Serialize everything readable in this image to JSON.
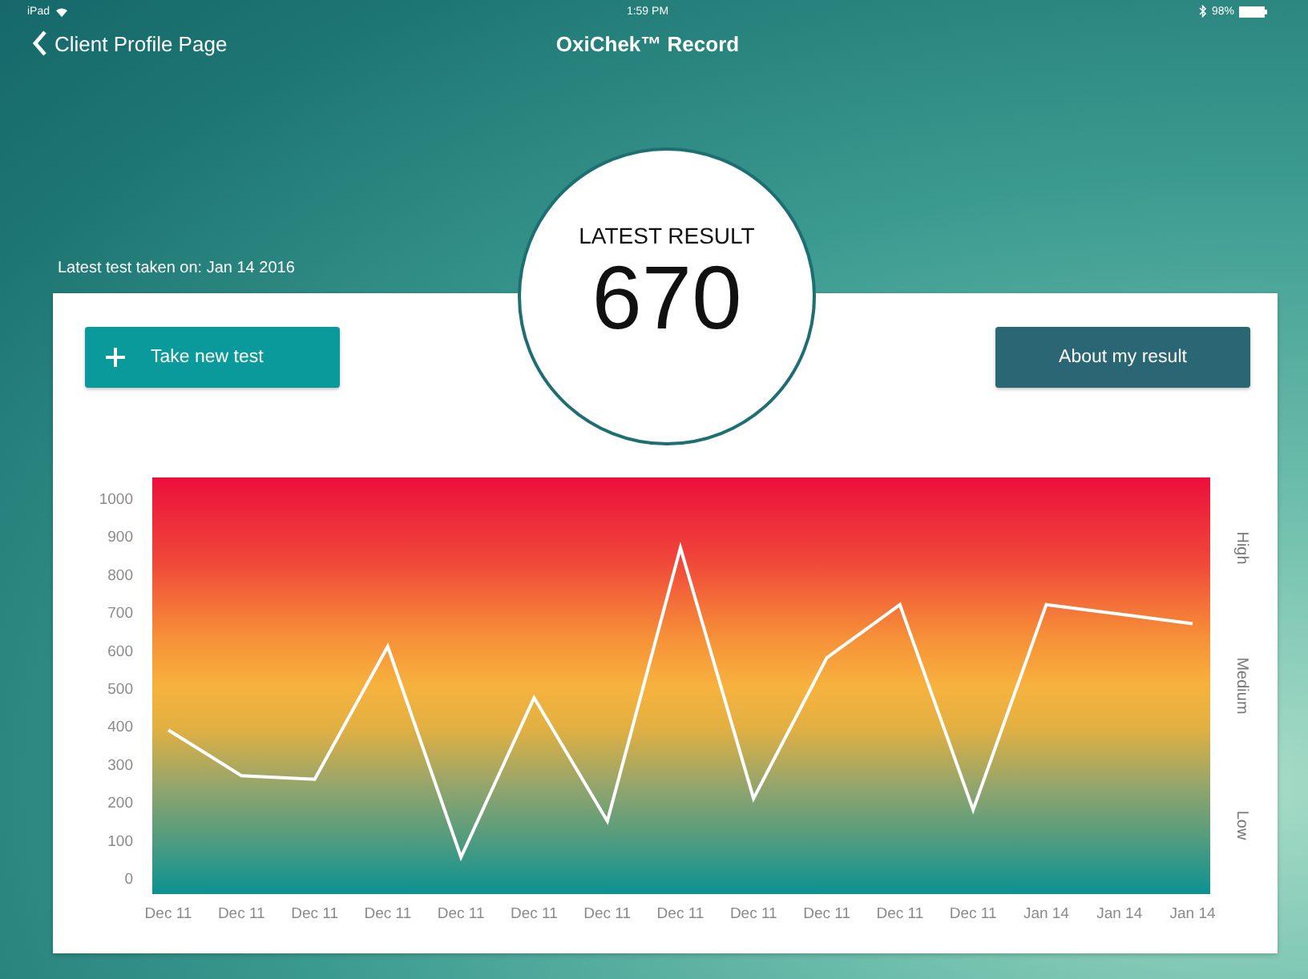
{
  "status_bar": {
    "device": "iPad",
    "time": "1:59 PM",
    "battery": "98%"
  },
  "nav": {
    "back_label": "Client Profile Page",
    "title": "OxiChek™ Record"
  },
  "latest": {
    "caption": "Latest test taken on: Jan 14 2016",
    "heading": "LATEST RESULT",
    "value": "670"
  },
  "buttons": [
    {
      "label": "Take new test",
      "kind": "primary"
    },
    {
      "label": "About my result",
      "kind": "secondary"
    }
  ],
  "chart": {
    "band_labels": [
      "High",
      "Medium",
      "Low"
    ],
    "chart_data": {
      "type": "line",
      "categories": [
        "Dec 11",
        "Dec 11",
        "Dec 11",
        "Dec 11",
        "Dec 11",
        "Dec 11",
        "Dec 11",
        "Dec 11",
        "Dec 11",
        "Dec 11",
        "Dec 11",
        "Dec 11",
        "Jan 14",
        "Jan 14",
        "Jan 14"
      ],
      "series": [
        {
          "color": "#ffffff",
          "values": [
            390,
            270,
            260,
            610,
            55,
            475,
            150,
            870,
            210,
            580,
            720,
            180,
            720,
            695,
            670
          ]
        }
      ],
      "ylim": [
        -42,
        1055
      ],
      "yticks": [
        0,
        100,
        200,
        300,
        400,
        500,
        600,
        700,
        800,
        900,
        1000
      ]
    }
  }
}
